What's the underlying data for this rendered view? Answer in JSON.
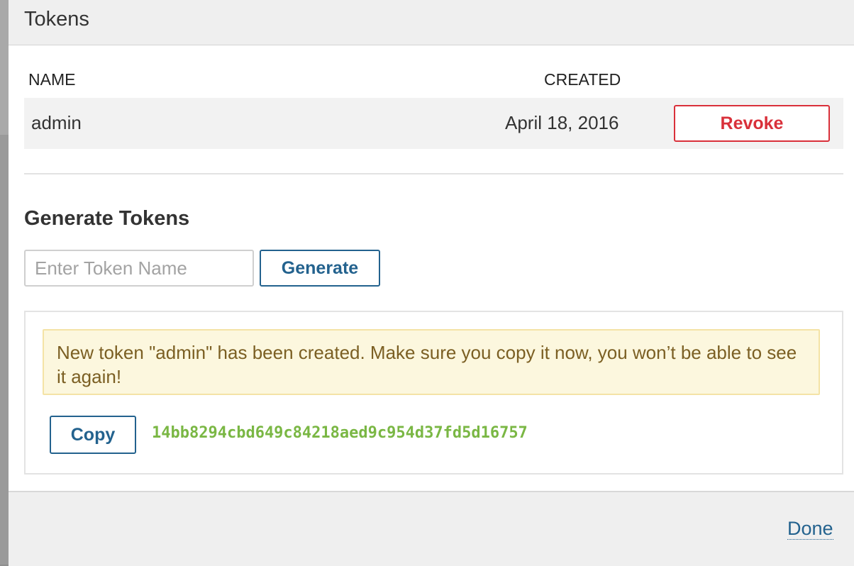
{
  "modal": {
    "title": "Tokens"
  },
  "table": {
    "headers": {
      "name": "NAME",
      "created": "CREATED"
    },
    "rows": [
      {
        "name": "admin",
        "created": "April 18, 2016",
        "action": "Revoke"
      }
    ]
  },
  "generate": {
    "title": "Generate Tokens",
    "input_placeholder": "Enter Token Name",
    "input_value": "",
    "button_label": "Generate"
  },
  "result": {
    "message": "New token \"admin\" has been created. Make sure you copy it now, you won’t be able to see it again!",
    "copy_label": "Copy",
    "token": "14bb8294cbd649c84218aed9c954d37fd5d16757"
  },
  "footer": {
    "done_label": "Done"
  },
  "colors": {
    "danger": "#d9303a",
    "primary": "#23628e",
    "token_text": "#7ab744",
    "warning_bg": "#fcf7de",
    "warning_text": "#7b5f23"
  }
}
